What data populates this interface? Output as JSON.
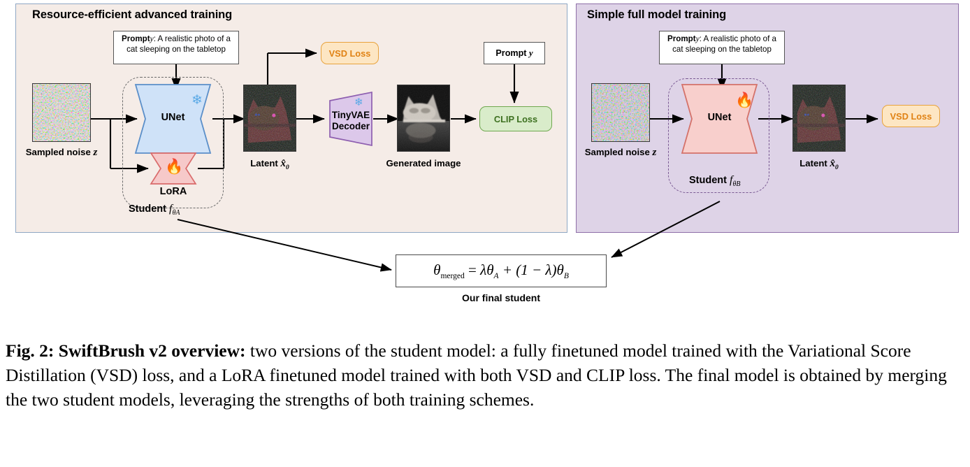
{
  "figure": {
    "caption_label": "Fig. 2:",
    "caption_title": "SwiftBrush v2 overview:",
    "caption_body": " two versions of the student model: a fully finetuned model trained with the Variational Score Distillation (VSD) loss, and a LoRA finetuned model trained with both VSD and CLIP loss. The final model is obtained by merging the two student models, leveraging the strengths of both training schemes."
  },
  "panels": {
    "left": {
      "title": "Resource-efficient advanced training",
      "background_color": "#f5ece7",
      "border_color": "#8fa7c4"
    },
    "right": {
      "title": "Simple full model training",
      "background_color": "#ded3e7",
      "border_color": "#8e6fa8"
    }
  },
  "left_panel": {
    "prompt": {
      "bold_prefix": "Prompt",
      "var": "y",
      "text": ": A realistic photo of a cat sleeping on the tabletop"
    },
    "noise_caption": "Sampled noise",
    "noise_var": "z",
    "unet_label": "UNet",
    "unet_icon": "snowflake-icon",
    "unet_fill": "#cfe2f8",
    "unet_border": "#5b8fc9",
    "lora_label": "LoRA",
    "lora_icon": "flame-icon",
    "lora_fill": "#f6c9c9",
    "lora_border": "#d96b6b",
    "student_label": "Student",
    "student_var": "f",
    "student_sub": "θA",
    "latent_caption": "Latent",
    "latent_var": "x̂",
    "latent_sub": "0",
    "decoder_line1": "TinyVAE",
    "decoder_line2": "Decoder",
    "decoder_icon": "snowflake-icon",
    "decoder_fill": "#dcc8ea",
    "decoder_border": "#8e5fb0",
    "generated_caption": "Generated image",
    "vsd_loss_label": "VSD Loss",
    "clip_loss_label": "CLIP Loss",
    "clip_prompt_bold": "Prompt",
    "clip_prompt_var": "y"
  },
  "right_panel": {
    "prompt": {
      "bold_prefix": "Prompt",
      "var": "y",
      "text": ": A realistic photo of a cat sleeping on the tabletop"
    },
    "noise_caption": "Sampled noise",
    "noise_var": "z",
    "unet_label": "UNet",
    "unet_icon": "flame-icon",
    "unet_fill": "#f8cfcc",
    "unet_border": "#d4726a",
    "student_label": "Student",
    "student_var": "f",
    "student_sub": "θB",
    "latent_caption": "Latent",
    "latent_var": "x̂",
    "latent_sub": "0",
    "vsd_loss_label": "VSD Loss"
  },
  "merge": {
    "formula_lhs": "θ",
    "formula_lhs_sub": "merged",
    "formula_eq": " = ",
    "formula_rhs": "λθ",
    "formula_rhs_sub_a": "A",
    "formula_mid": " + (1 − λ)θ",
    "formula_rhs_sub_b": "B",
    "final_caption": "Our final student"
  },
  "colors": {
    "vsd_loss_fill": "#fde6c3",
    "vsd_loss_border": "#e8a33d",
    "vsd_loss_text": "#e08214",
    "clip_loss_fill": "#d9ecca",
    "clip_loss_border": "#6fa84f",
    "clip_loss_text": "#3d7020"
  }
}
